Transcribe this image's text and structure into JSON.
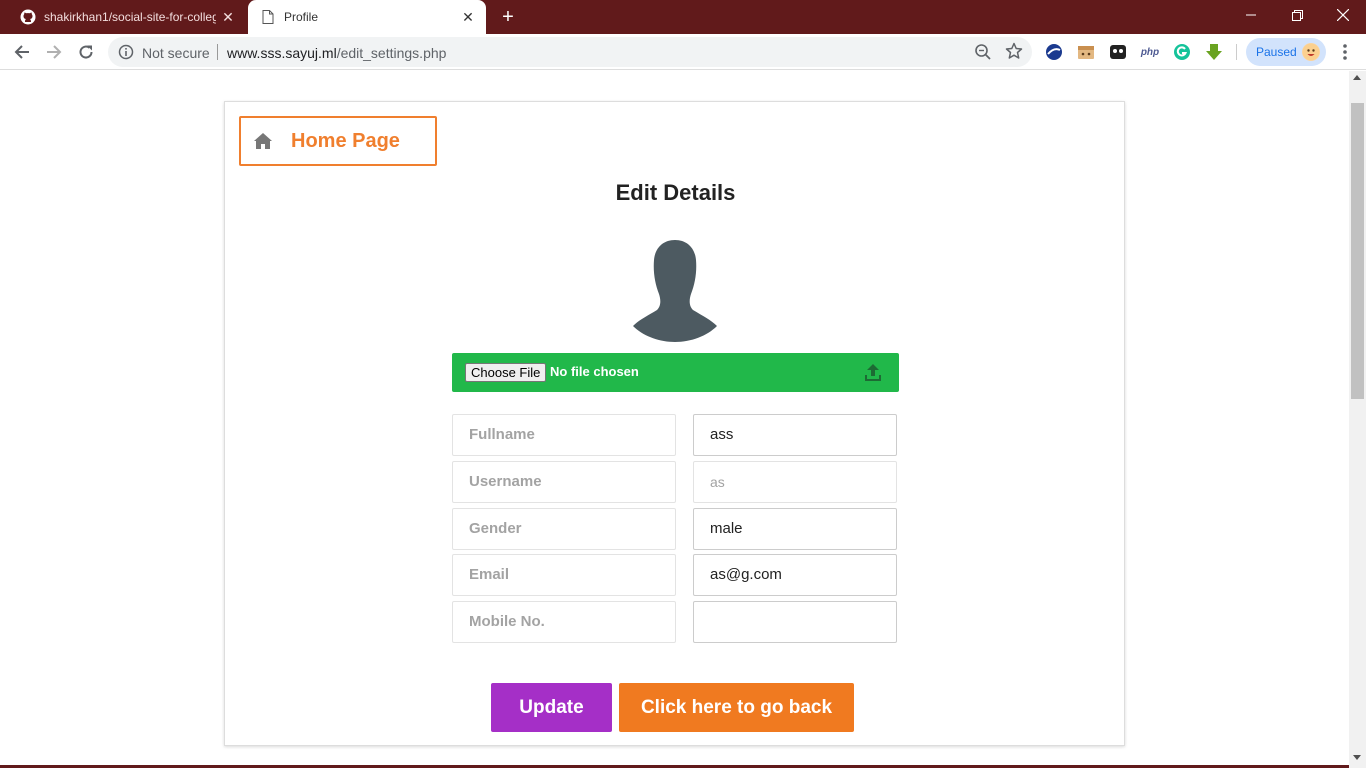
{
  "browser": {
    "tabs": [
      {
        "title": "shakirkhan1/social-site-for-college",
        "icon": "github-icon",
        "active": false
      },
      {
        "title": "Profile",
        "icon": "page-icon",
        "active": true
      }
    ],
    "omnibox": {
      "security_label": "Not secure",
      "url_host": "www.sss.sayuj.ml",
      "url_path": "/edit_settings.php"
    },
    "extensions": [
      "blue-globe-extension-icon",
      "box-extension-icon",
      "face-extension-icon",
      "php-extension-icon",
      "grammarly-extension-icon",
      "download-extension-icon"
    ],
    "php_label": "php",
    "profile": {
      "label": "Paused"
    }
  },
  "page": {
    "home_button": "Home Page",
    "title": "Edit Details",
    "upload": {
      "button_label": "Choose File",
      "status": "No file chosen"
    },
    "fields": [
      {
        "label": "Fullname",
        "value": "ass",
        "disabled": false
      },
      {
        "label": "Username",
        "value": "as",
        "disabled": true
      },
      {
        "label": "Gender",
        "value": "male",
        "disabled": false
      },
      {
        "label": "Email",
        "value": "as@g.com",
        "disabled": false
      },
      {
        "label": "Mobile No.",
        "value": "",
        "disabled": false
      }
    ],
    "update_button": "Update",
    "back_button": "Click here to go back"
  },
  "colors": {
    "tabstrip": "#611a1b",
    "accent_orange": "#f07f2e",
    "upload_green": "#21b84a",
    "update_purple": "#a52fc7",
    "back_orange": "#f07a20",
    "avatar_gray": "#4d5a61"
  }
}
